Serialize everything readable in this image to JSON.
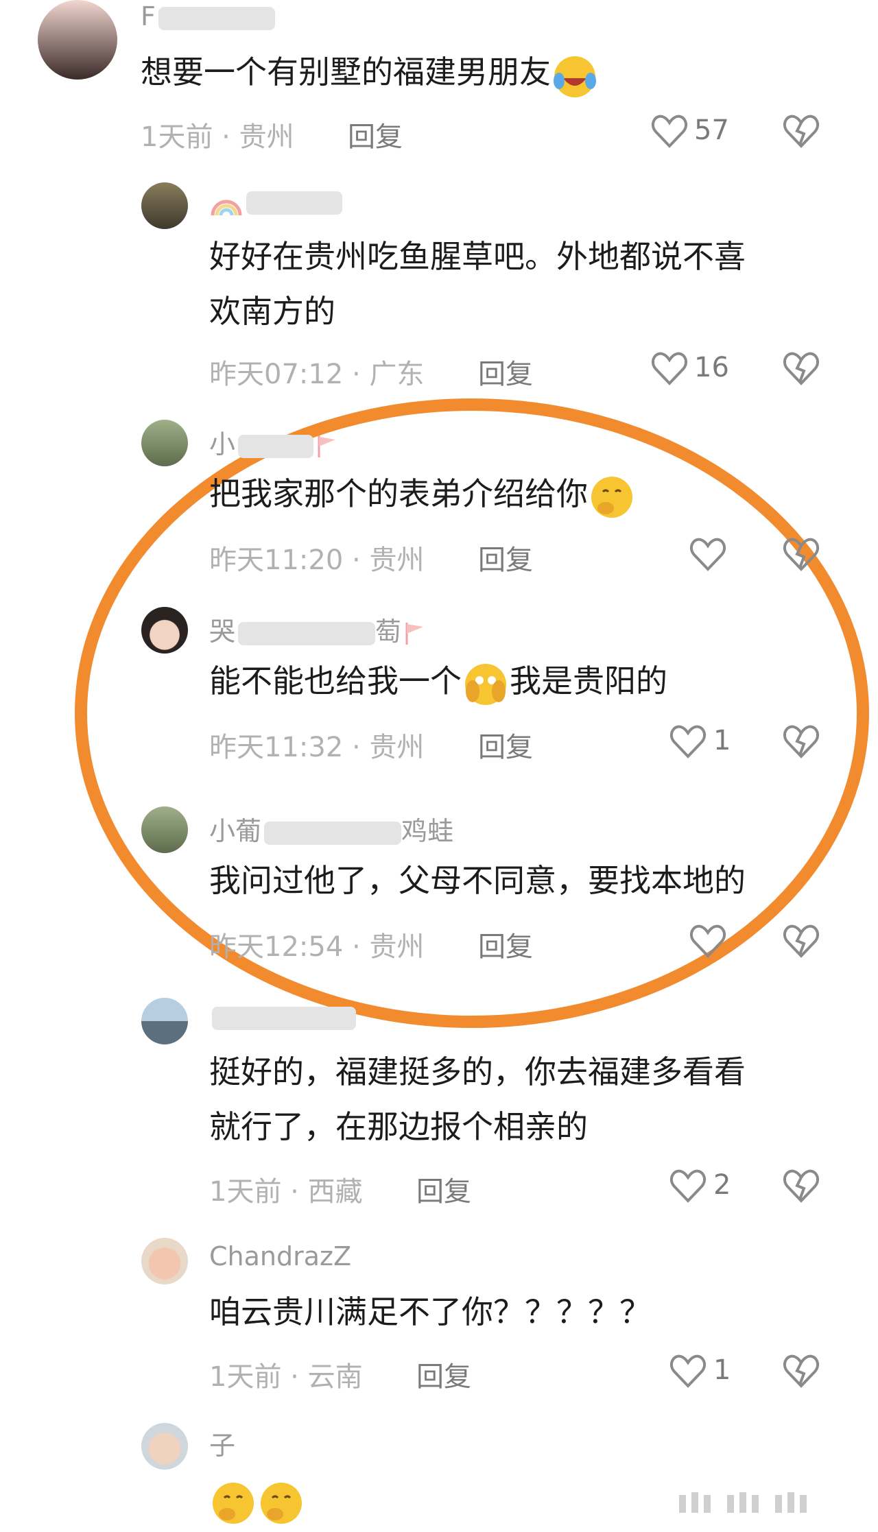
{
  "comments": [
    {
      "user": "F",
      "text": "想要一个有别墅的福建男朋友",
      "time": "1天前",
      "loc": "贵州",
      "reply": "回复",
      "likes": "57"
    },
    {
      "user": "",
      "text1": "好好在贵州吃鱼腥草吧。外地都说不喜",
      "text2": "欢南方的",
      "time": "昨天07:12",
      "loc": "广东",
      "reply": "回复",
      "likes": "16"
    },
    {
      "user": "小",
      "text": "把我家那个的表弟介绍给你",
      "time": "昨天11:20",
      "loc": "贵州",
      "reply": "回复",
      "likes": ""
    },
    {
      "user": "哭",
      "user_tail": "萄",
      "text_a": "能不能也给我一个",
      "text_b": "我是贵阳的",
      "time": "昨天11:32",
      "loc": "贵州",
      "reply": "回复",
      "likes": "1"
    },
    {
      "user": "小葡",
      "user_tail": "鸡蛙",
      "text": "我问过他了，父母不同意，要找本地的",
      "time": "昨天12:54",
      "loc": "贵州",
      "reply": "回复",
      "likes": ""
    },
    {
      "user": "",
      "text1": "挺好的，福建挺多的，你去福建多看看",
      "text2": "就行了，在那边报个相亲的",
      "time": "1天前",
      "loc": "西藏",
      "reply": "回复",
      "likes": "2"
    },
    {
      "user": "ChandrazZ",
      "text": "咱云贵川满足不了你？？？？？",
      "time": "1天前",
      "loc": "云南",
      "reply": "回复",
      "likes": "1"
    },
    {
      "user": "子",
      "text": "",
      "time": "",
      "loc": "",
      "reply": "",
      "likes": ""
    }
  ],
  "separator": " · ",
  "colors": {
    "highlight": "#f28a2e",
    "meta": "#b1b1b1",
    "text": "#1c1c1c"
  }
}
